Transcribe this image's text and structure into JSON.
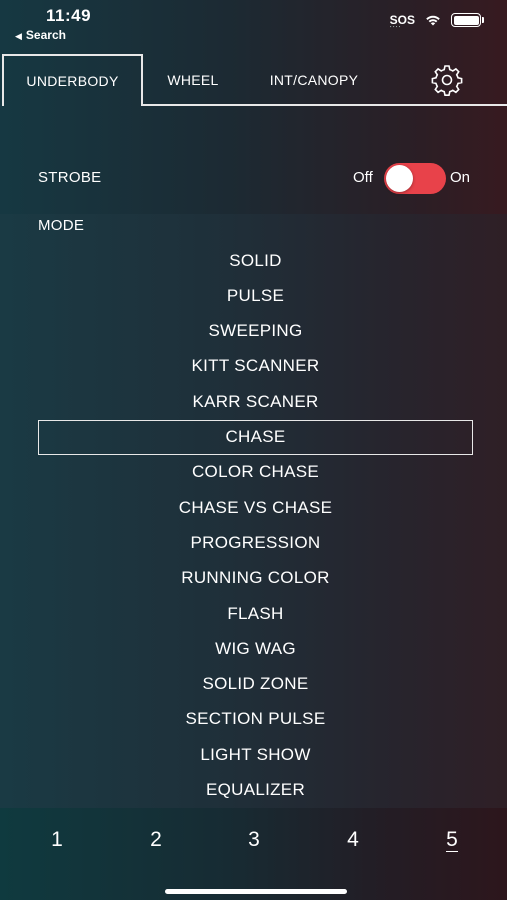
{
  "status_bar": {
    "time": "11:49",
    "back_label": "Search",
    "carrier": "SOS"
  },
  "tabs": [
    {
      "label": "UNDERBODY",
      "active": true
    },
    {
      "label": "WHEEL",
      "active": false
    },
    {
      "label": "INT/CANOPY",
      "active": false
    }
  ],
  "settings_icon": "gear-icon",
  "strobe": {
    "label": "STROBE",
    "off_label": "Off",
    "on_label": "On",
    "state": "on",
    "toggle_color": "#e8424a"
  },
  "mode": {
    "label": "MODE",
    "selected": "CHASE",
    "options": [
      "SOLID",
      "PULSE",
      "SWEEPING",
      "KITT SCANNER",
      "KARR SCANER",
      "CHASE",
      "COLOR CHASE",
      "CHASE VS CHASE",
      "PROGRESSION",
      "RUNNING COLOR",
      "FLASH",
      "WIG WAG",
      "SOLID ZONE",
      "SECTION PULSE",
      "LIGHT SHOW",
      "EQUALIZER"
    ]
  },
  "pages": {
    "items": [
      "1",
      "2",
      "3",
      "4",
      "5"
    ],
    "current": "5"
  }
}
